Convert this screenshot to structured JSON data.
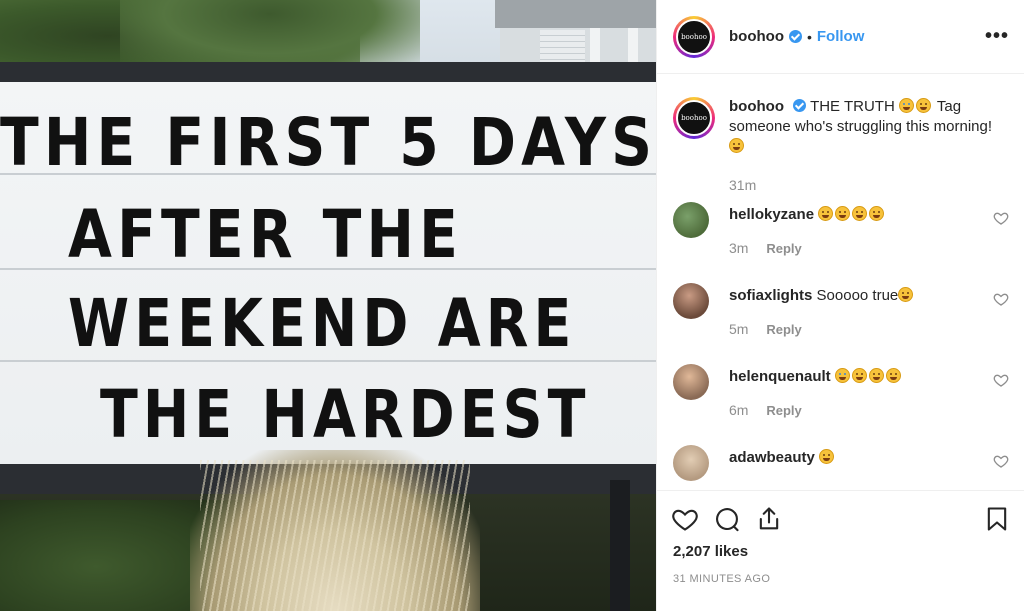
{
  "photo": {
    "sign_lines": [
      "THE FIRST 5 DAYS",
      "AFTER THE",
      "WEEKEND ARE",
      "THE HARDEST"
    ]
  },
  "account": {
    "avatar_text": "boohoo",
    "username": "boohoo",
    "verified": true,
    "separator": "•",
    "follow_label": "Follow",
    "more_label": "•••"
  },
  "caption": {
    "username": "boohoo",
    "text_part1": "THE TRUTH",
    "text_part2": "Tag someone who's struggling this morning!",
    "time": "31m"
  },
  "comments": [
    {
      "username": "hellokyzane",
      "text": "",
      "emoji_count": 4,
      "time": "3m",
      "reply_label": "Reply",
      "avatar_color": "#4e6b3a"
    },
    {
      "username": "sofiaxlights",
      "text": "Sooooo true",
      "emoji_count": 1,
      "time": "5m",
      "reply_label": "Reply",
      "avatar_color": "#6b4a3a"
    },
    {
      "username": "helenquenault",
      "text": "",
      "emoji_count": 4,
      "time": "6m",
      "reply_label": "Reply",
      "avatar_color": "#8a6a55"
    },
    {
      "username": "adawbeauty",
      "text": "",
      "emoji_count": 1,
      "time": "",
      "reply_label": "",
      "avatar_color": "#b49a80"
    }
  ],
  "footer": {
    "likes": "2,207 likes",
    "time_ago": "31 MINUTES AGO"
  },
  "icons": [
    "heart-icon",
    "comment-icon",
    "share-icon",
    "bookmark-icon",
    "more-icon",
    "verified-icon"
  ],
  "colors": {
    "link": "#3897f0",
    "muted": "#8e8e8e",
    "text": "#262626",
    "border": "#efefef"
  }
}
